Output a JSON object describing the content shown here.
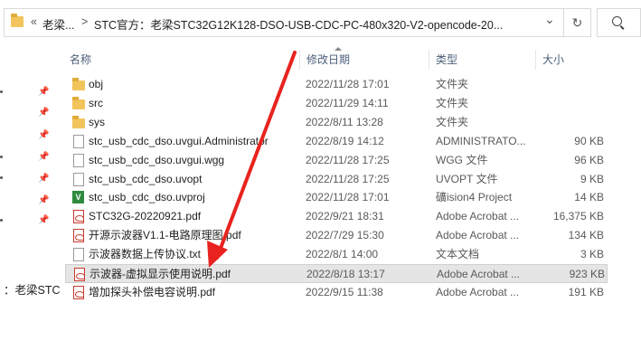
{
  "address": {
    "overflow": "«",
    "crumb1": "老梁...",
    "separator1": ">",
    "crumb2": "STC官方：老梁STC32G12K128-DSO-USB-CDC-PC-480x320-V2-opencode-20...",
    "dropdown": "⌄",
    "refresh": "↻"
  },
  "nav": {
    "label": "：老梁STC"
  },
  "columns": {
    "name": "名称",
    "date": "修改日期",
    "type": "类型",
    "size": "大小"
  },
  "files": [
    {
      "icon": "folder",
      "name": "obj",
      "date": "2022/11/28 17:01",
      "type": "文件夹",
      "size": ""
    },
    {
      "icon": "folder",
      "name": "src",
      "date": "2022/11/29 14:11",
      "type": "文件夹",
      "size": ""
    },
    {
      "icon": "folder",
      "name": "sys",
      "date": "2022/8/11 13:28",
      "type": "文件夹",
      "size": ""
    },
    {
      "icon": "file",
      "name": "stc_usb_cdc_dso.uvgui.Administrator",
      "date": "2022/8/19 14:12",
      "type": "ADMINISTRATO...",
      "size": "90 KB"
    },
    {
      "icon": "file",
      "name": "stc_usb_cdc_dso.uvgui.wgg",
      "date": "2022/11/28 17:25",
      "type": "WGG 文件",
      "size": "96 KB"
    },
    {
      "icon": "file",
      "name": "stc_usb_cdc_dso.uvopt",
      "date": "2022/11/28 17:25",
      "type": "UVOPT 文件",
      "size": "9 KB"
    },
    {
      "icon": "vs",
      "name": "stc_usb_cdc_dso.uvproj",
      "date": "2022/11/28 17:01",
      "type": "礦ision4 Project",
      "size": "14 KB"
    },
    {
      "icon": "pdf",
      "name": "STC32G-20220921.pdf",
      "date": "2022/9/21 18:31",
      "type": "Adobe Acrobat ...",
      "size": "16,375 KB"
    },
    {
      "icon": "pdf",
      "name": "开源示波器V1.1-电路原理图.pdf",
      "date": "2022/7/29 15:30",
      "type": "Adobe Acrobat ...",
      "size": "134 KB"
    },
    {
      "icon": "file",
      "name": "示波器数据上传协议.txt",
      "date": "2022/8/1 14:00",
      "type": "文本文档",
      "size": "3 KB"
    },
    {
      "icon": "pdf",
      "name": "示波器-虚拟显示使用说明.pdf",
      "date": "2022/8/18 13:17",
      "type": "Adobe Acrobat ...",
      "size": "923 KB",
      "selected": true
    },
    {
      "icon": "pdf",
      "name": "增加探头补偿电容说明.pdf",
      "date": "2022/9/15 11:38",
      "type": "Adobe Acrobat ...",
      "size": "191 KB"
    }
  ],
  "colors": {
    "arrow": "#e8231f",
    "selection": "#e5e5e5",
    "header_text": "#4c607a"
  }
}
